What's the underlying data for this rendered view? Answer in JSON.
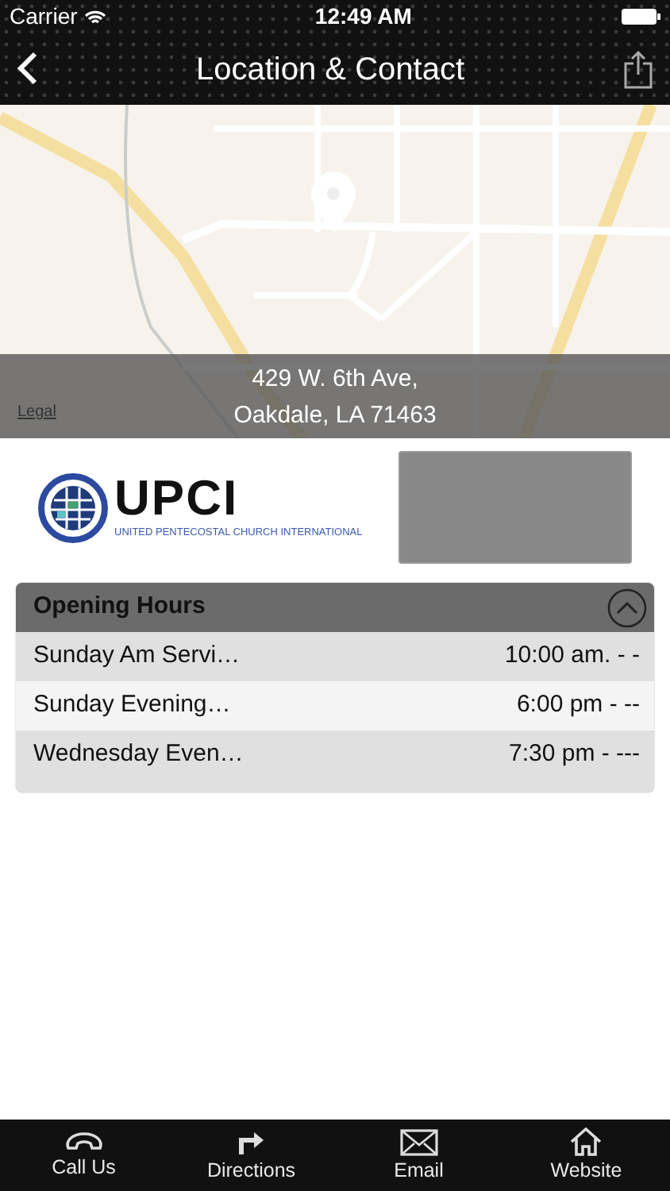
{
  "status_bar": {
    "carrier": "Carrier",
    "time": "12:49 AM"
  },
  "nav_bar": {
    "title": "Location & Contact"
  },
  "map": {
    "kind": "picture",
    "legal": "Legal",
    "address_lines": [
      "429 W. 6th Ave,",
      "Oakdale, LA 71463"
    ]
  },
  "logo": {
    "name": "UPCI",
    "tagline": "UNITED PENTECOSTAL CHURCH INTERNATIONAL"
  },
  "opening_hours": {
    "title": "Opening Hours",
    "expanded": true,
    "rows": [
      {
        "name": "Sunday Am Servi…",
        "time": "10:00 am. - -"
      },
      {
        "name": "Sunday Evening…",
        "time": "6:00 pm - --"
      },
      {
        "name": "Wednesday Even…",
        "time": "7:30 pm - ---"
      }
    ]
  },
  "tab_bar": [
    {
      "kind": "phone",
      "label": "Call Us"
    },
    {
      "kind": "directions",
      "label": "Directions"
    },
    {
      "kind": "email",
      "label": "Email"
    },
    {
      "kind": "home",
      "label": "Website"
    }
  ]
}
